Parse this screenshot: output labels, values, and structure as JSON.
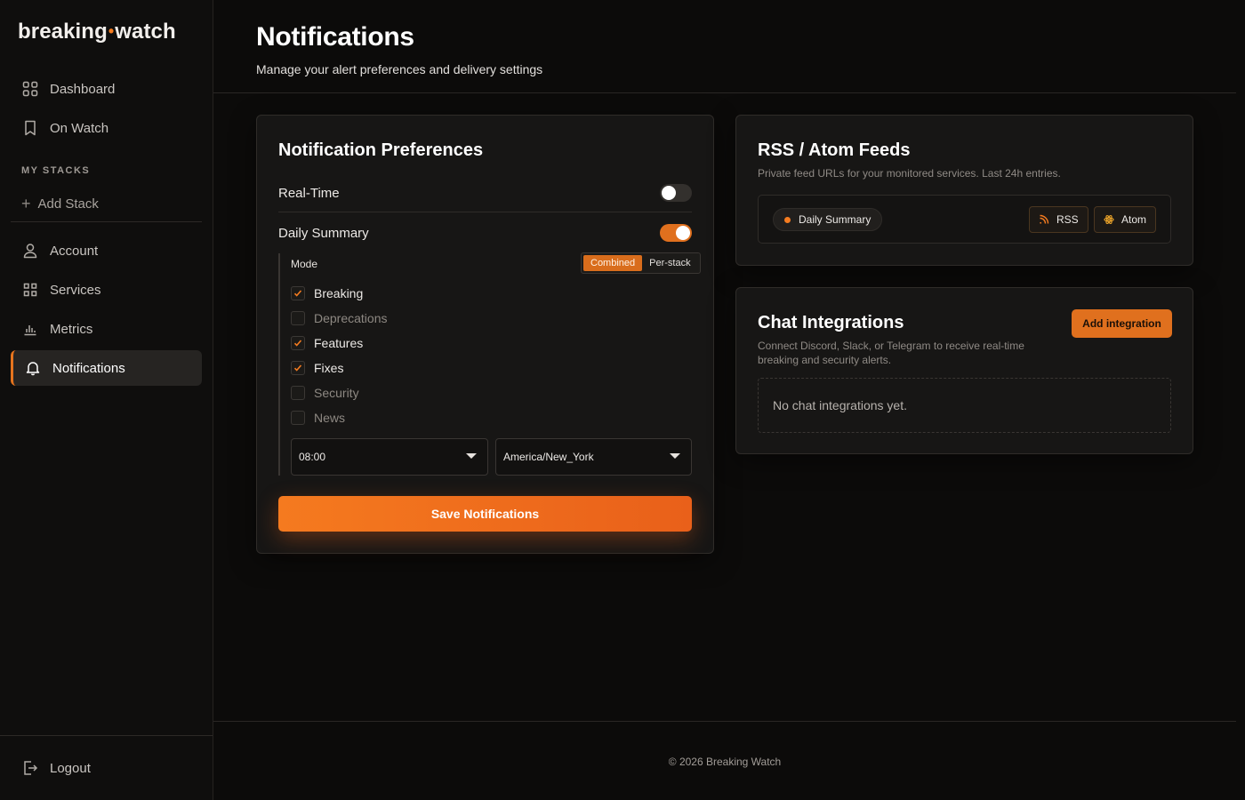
{
  "brand": {
    "part1": "breaking",
    "dot": "•",
    "part2": "watch"
  },
  "sidebar": {
    "items": [
      {
        "label": "Dashboard"
      },
      {
        "label": "On Watch"
      }
    ],
    "section_label": "MY STACKS",
    "add_stack": "Add Stack",
    "account_items": [
      {
        "label": "Account"
      },
      {
        "label": "Services"
      },
      {
        "label": "Metrics"
      },
      {
        "label": "Notifications"
      }
    ],
    "logout": "Logout"
  },
  "header": {
    "title": "Notifications",
    "subtitle": "Manage your alert preferences and delivery settings"
  },
  "preferences": {
    "title": "Notification Preferences",
    "realtime_label": "Real-Time",
    "realtime_on": false,
    "daily_label": "Daily Summary",
    "daily_on": true,
    "mode_label": "Mode",
    "mode_options": [
      "Combined",
      "Per-stack"
    ],
    "mode_selected": "Combined",
    "categories": [
      {
        "label": "Breaking",
        "checked": true
      },
      {
        "label": "Deprecations",
        "checked": false
      },
      {
        "label": "Features",
        "checked": true
      },
      {
        "label": "Fixes",
        "checked": true
      },
      {
        "label": "Security",
        "checked": false
      },
      {
        "label": "News",
        "checked": false
      }
    ],
    "time_value": "08:00",
    "timezone_value": "America/New_York",
    "save_label": "Save Notifications"
  },
  "feeds": {
    "title": "RSS / Atom Feeds",
    "description": "Private feed URLs for your monitored services. Last 24h entries.",
    "pill_label": "Daily Summary",
    "rss_label": "RSS",
    "atom_label": "Atom"
  },
  "chat": {
    "title": "Chat Integrations",
    "description": "Connect Discord, Slack, or Telegram to receive real-time breaking and security alerts.",
    "add_label": "Add integration",
    "empty_text": "No chat integrations yet."
  },
  "footer": {
    "text": "© 2026 Breaking Watch"
  },
  "colors": {
    "accent": "#e5741e",
    "background": "#0c0b0a",
    "card": "#171615"
  }
}
